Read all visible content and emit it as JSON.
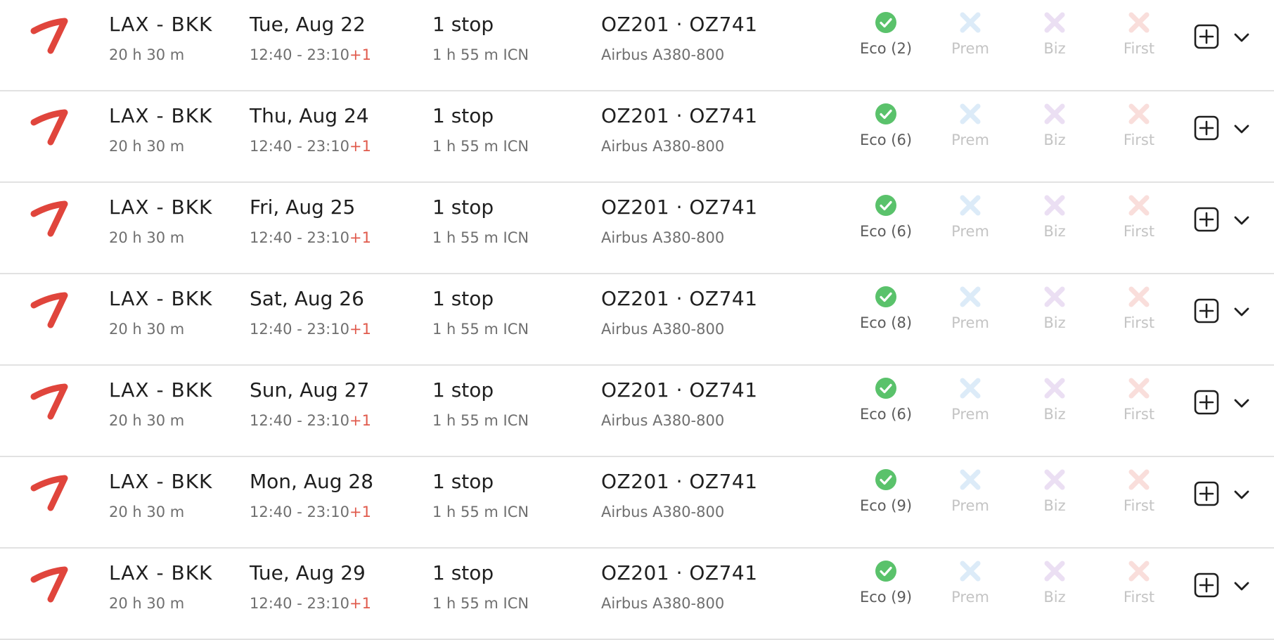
{
  "colors": {
    "airline_logo": "#e0453c",
    "available": "#5ac26b",
    "prem_unavailable": "#dcebf8",
    "biz_unavailable": "#ebdff3",
    "first_unavailable": "#f9dedb",
    "plus_one": "#e05a4c"
  },
  "icons": {
    "airline": "airline-logo-icon",
    "available": "check-circle-icon",
    "unavailable": "x-icon",
    "add": "plus-square-icon",
    "expand": "chevron-down-icon"
  },
  "flights": [
    {
      "route": "LAX - BKK",
      "duration": "20 h 30 m",
      "date": "Tue, Aug 22",
      "times": "12:40 - 23:10",
      "day_offset": "+1",
      "stops": "1 stop",
      "layover": "1 h 55 m  ICN",
      "flight_numbers": "OZ201  ·  OZ741",
      "aircraft": "Airbus A380-800",
      "cabins": {
        "eco": "Eco (2)",
        "prem": "Prem",
        "biz": "Biz",
        "first": "First"
      },
      "availability": {
        "eco": true,
        "prem": false,
        "biz": false,
        "first": false
      }
    },
    {
      "route": "LAX - BKK",
      "duration": "20 h 30 m",
      "date": "Thu, Aug 24",
      "times": "12:40 - 23:10",
      "day_offset": "+1",
      "stops": "1 stop",
      "layover": "1 h 55 m  ICN",
      "flight_numbers": "OZ201  ·  OZ741",
      "aircraft": "Airbus A380-800",
      "cabins": {
        "eco": "Eco (6)",
        "prem": "Prem",
        "biz": "Biz",
        "first": "First"
      },
      "availability": {
        "eco": true,
        "prem": false,
        "biz": false,
        "first": false
      }
    },
    {
      "route": "LAX - BKK",
      "duration": "20 h 30 m",
      "date": "Fri, Aug 25",
      "times": "12:40 - 23:10",
      "day_offset": "+1",
      "stops": "1 stop",
      "layover": "1 h 55 m  ICN",
      "flight_numbers": "OZ201  ·  OZ741",
      "aircraft": "Airbus A380-800",
      "cabins": {
        "eco": "Eco (6)",
        "prem": "Prem",
        "biz": "Biz",
        "first": "First"
      },
      "availability": {
        "eco": true,
        "prem": false,
        "biz": false,
        "first": false
      }
    },
    {
      "route": "LAX - BKK",
      "duration": "20 h 30 m",
      "date": "Sat, Aug 26",
      "times": "12:40 - 23:10",
      "day_offset": "+1",
      "stops": "1 stop",
      "layover": "1 h 55 m  ICN",
      "flight_numbers": "OZ201  ·  OZ741",
      "aircraft": "Airbus A380-800",
      "cabins": {
        "eco": "Eco (8)",
        "prem": "Prem",
        "biz": "Biz",
        "first": "First"
      },
      "availability": {
        "eco": true,
        "prem": false,
        "biz": false,
        "first": false
      }
    },
    {
      "route": "LAX - BKK",
      "duration": "20 h 30 m",
      "date": "Sun, Aug 27",
      "times": "12:40 - 23:10",
      "day_offset": "+1",
      "stops": "1 stop",
      "layover": "1 h 55 m  ICN",
      "flight_numbers": "OZ201  ·  OZ741",
      "aircraft": "Airbus A380-800",
      "cabins": {
        "eco": "Eco (6)",
        "prem": "Prem",
        "biz": "Biz",
        "first": "First"
      },
      "availability": {
        "eco": true,
        "prem": false,
        "biz": false,
        "first": false
      }
    },
    {
      "route": "LAX - BKK",
      "duration": "20 h 30 m",
      "date": "Mon, Aug 28",
      "times": "12:40 - 23:10",
      "day_offset": "+1",
      "stops": "1 stop",
      "layover": "1 h 55 m  ICN",
      "flight_numbers": "OZ201  ·  OZ741",
      "aircraft": "Airbus A380-800",
      "cabins": {
        "eco": "Eco (9)",
        "prem": "Prem",
        "biz": "Biz",
        "first": "First"
      },
      "availability": {
        "eco": true,
        "prem": false,
        "biz": false,
        "first": false
      }
    },
    {
      "route": "LAX - BKK",
      "duration": "20 h 30 m",
      "date": "Tue, Aug 29",
      "times": "12:40 - 23:10",
      "day_offset": "+1",
      "stops": "1 stop",
      "layover": "1 h 55 m  ICN",
      "flight_numbers": "OZ201  ·  OZ741",
      "aircraft": "Airbus A380-800",
      "cabins": {
        "eco": "Eco (9)",
        "prem": "Prem",
        "biz": "Biz",
        "first": "First"
      },
      "availability": {
        "eco": true,
        "prem": false,
        "biz": false,
        "first": false
      }
    }
  ]
}
